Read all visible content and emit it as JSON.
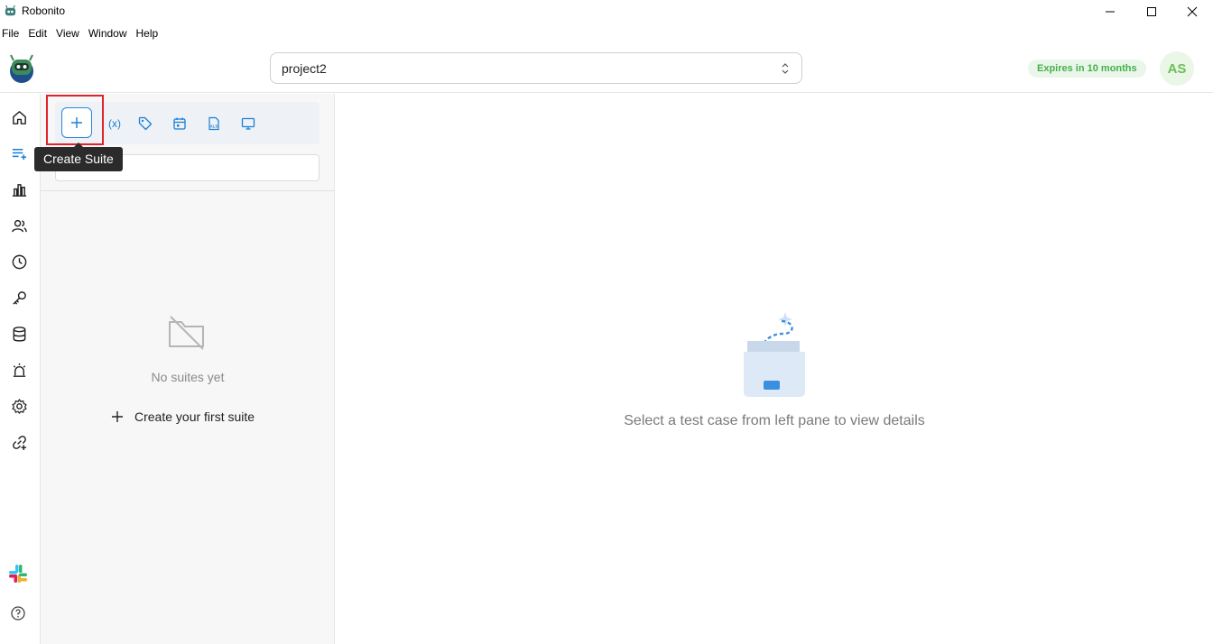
{
  "window": {
    "title": "Robonito",
    "controls": [
      "minimize",
      "maximize",
      "close"
    ]
  },
  "menu": {
    "items": [
      "File",
      "Edit",
      "View",
      "Window",
      "Help"
    ]
  },
  "header": {
    "project": "project2",
    "license_badge": "Expires in 10 months",
    "avatar_initials": "AS"
  },
  "nav": {
    "icons": [
      "home-icon",
      "test-suites-icon",
      "reports-icon",
      "users-icon",
      "history-icon",
      "key-icon",
      "database-icon",
      "alerts-icon",
      "settings-icon",
      "integrations-icon",
      "slack-icon",
      "help-icon"
    ]
  },
  "suite_panel": {
    "tooltip": "Create Suite",
    "tools": [
      "create-suite",
      "variables",
      "tags",
      "schedule",
      "excel",
      "devices"
    ],
    "variables_label": "(x)",
    "excel_label": "XLS",
    "empty_text": "No suites yet",
    "create_first_label": "Create your first suite"
  },
  "main": {
    "message": "Select a test case from left pane to view details"
  },
  "colors": {
    "accent": "#1a7fd6",
    "badge_text": "#47b04b",
    "highlight": "#e0242b"
  }
}
